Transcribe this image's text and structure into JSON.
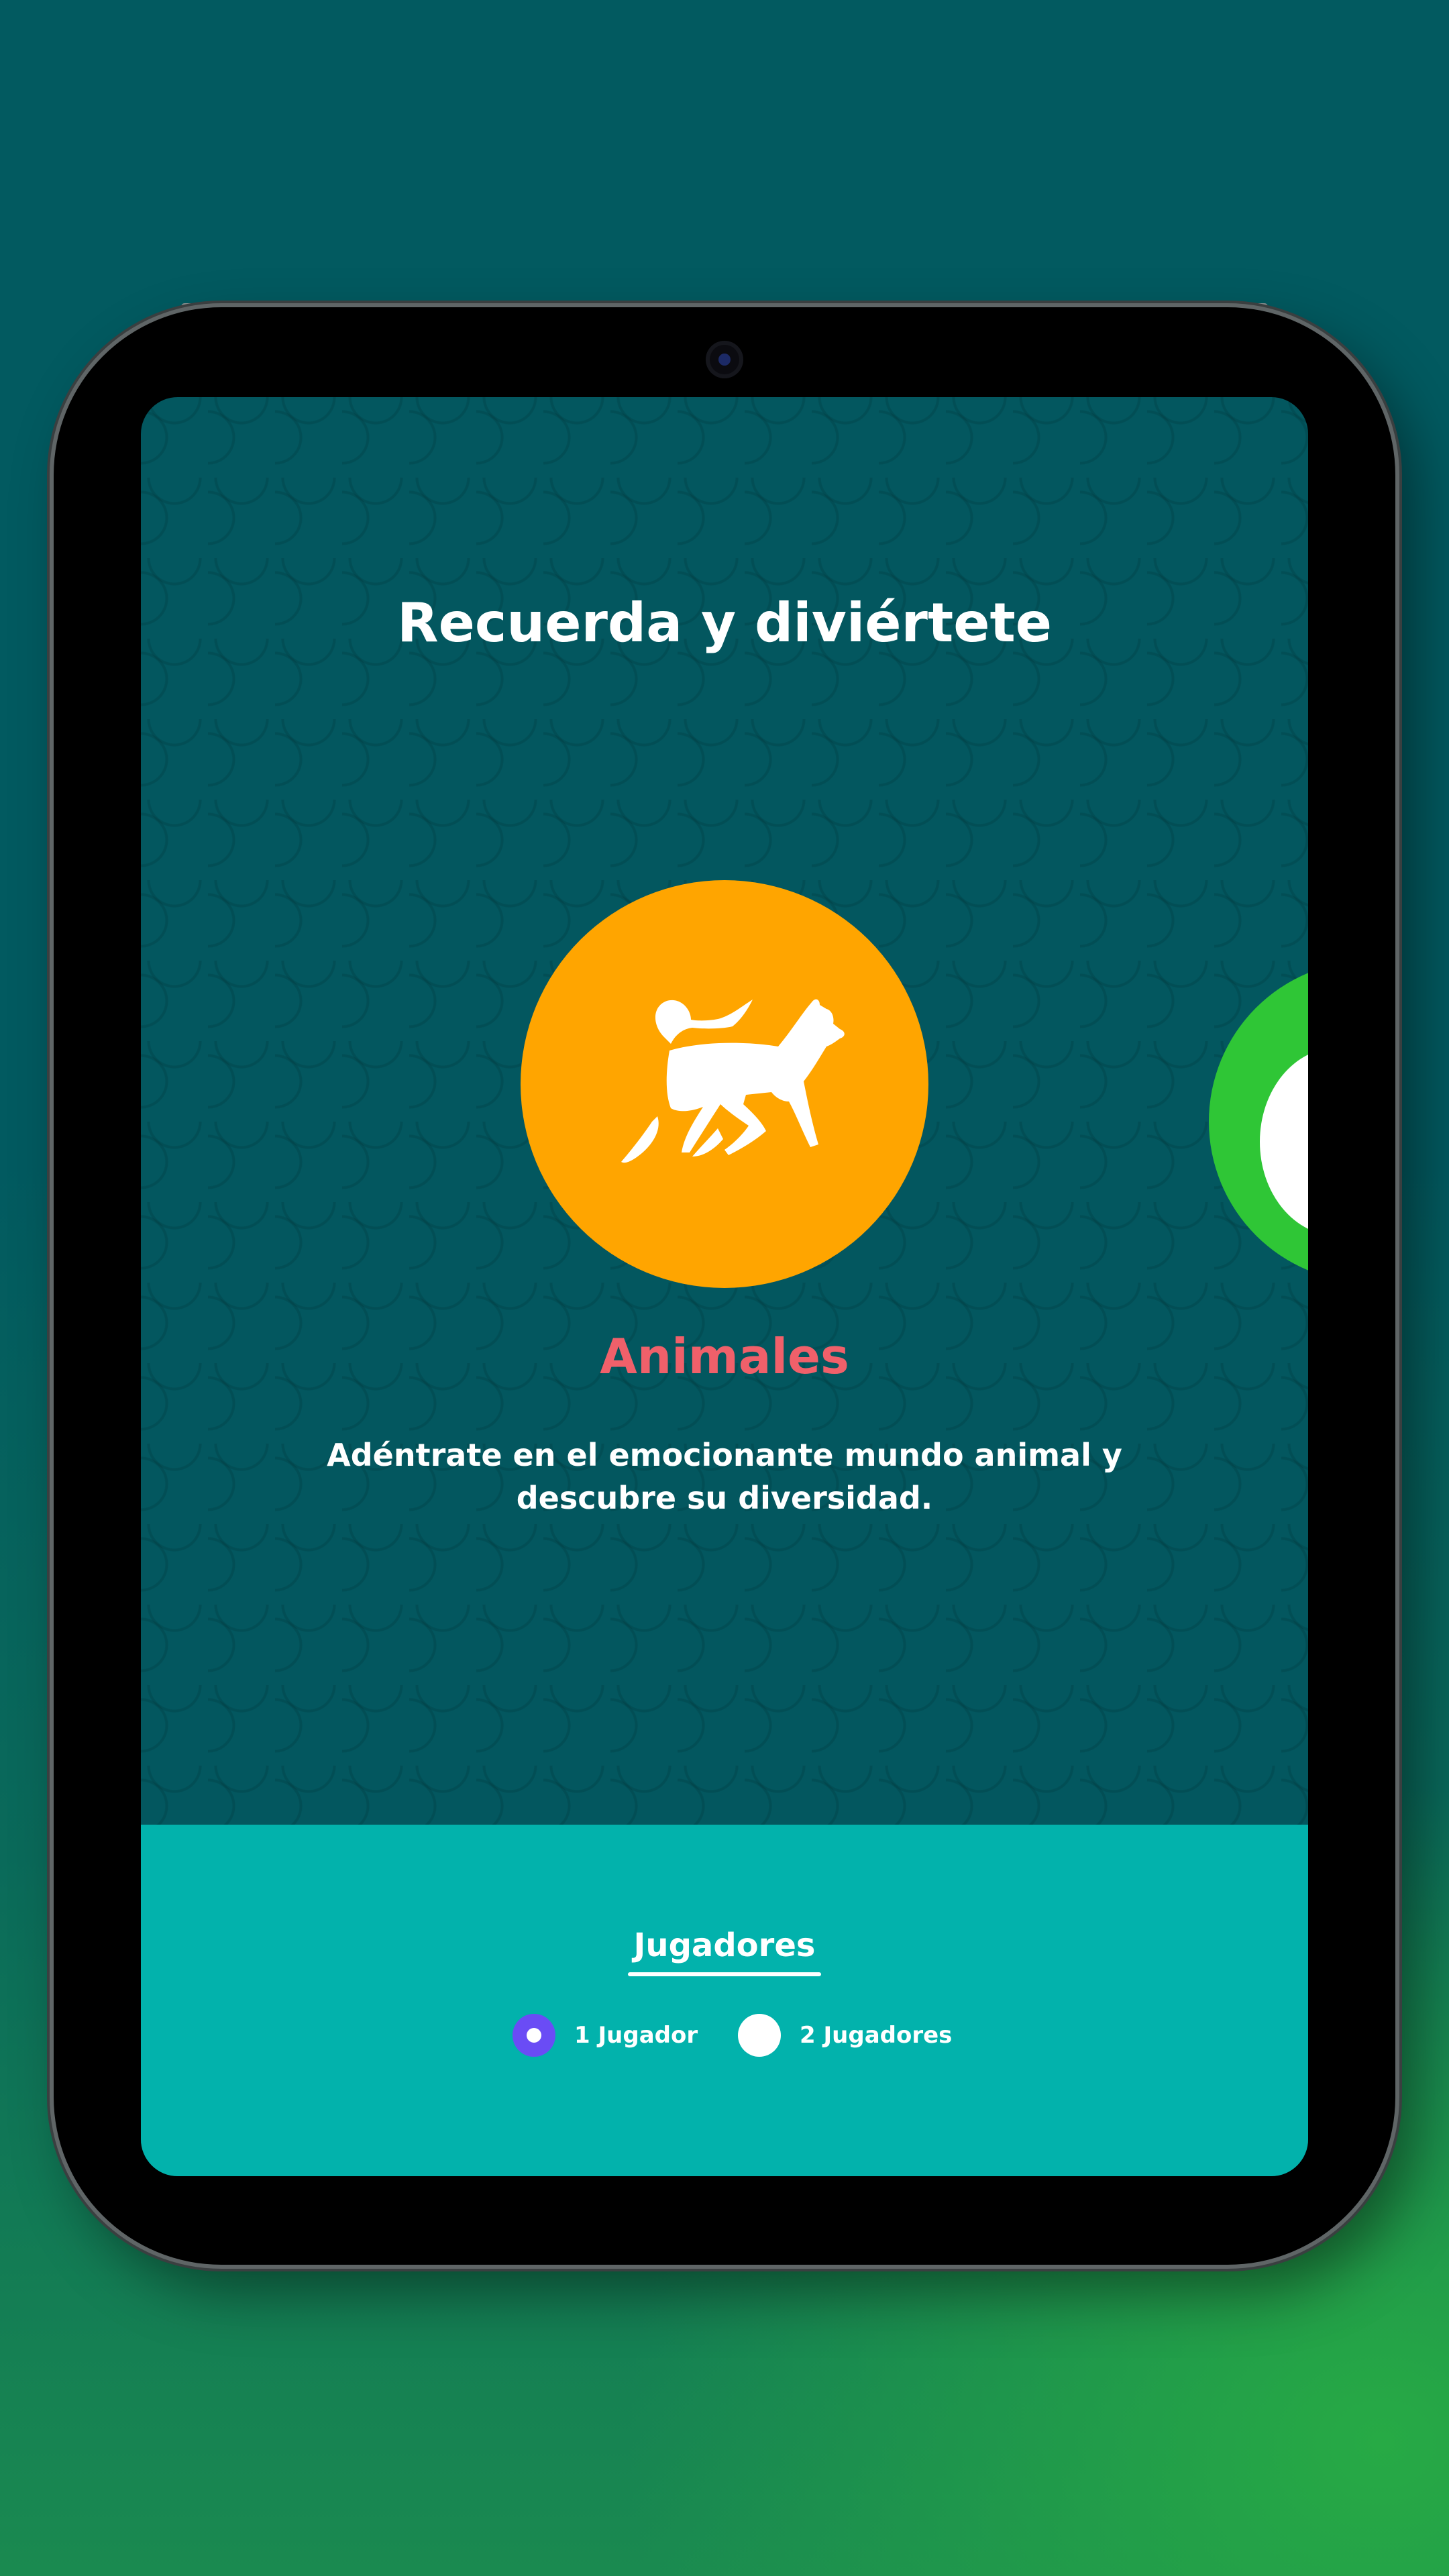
{
  "header": {
    "title": "Recuerda y diviértete"
  },
  "carousel": {
    "current": {
      "name": "Animales",
      "description": "Adéntrate en el emocionante mundo animal y descubre su diversidad.",
      "icon": "cat-icon",
      "color": "#ffa500",
      "name_color": "#f0606a"
    },
    "next": {
      "color": "#2fc636"
    }
  },
  "players": {
    "title": "Jugadores",
    "options": [
      {
        "label": "1 Jugador",
        "selected": true
      },
      {
        "label": "2 Jugadores",
        "selected": false
      }
    ],
    "selected_color": "#6a4cf5"
  },
  "colors": {
    "background": "#03575f",
    "footer": "#02b2ac"
  }
}
